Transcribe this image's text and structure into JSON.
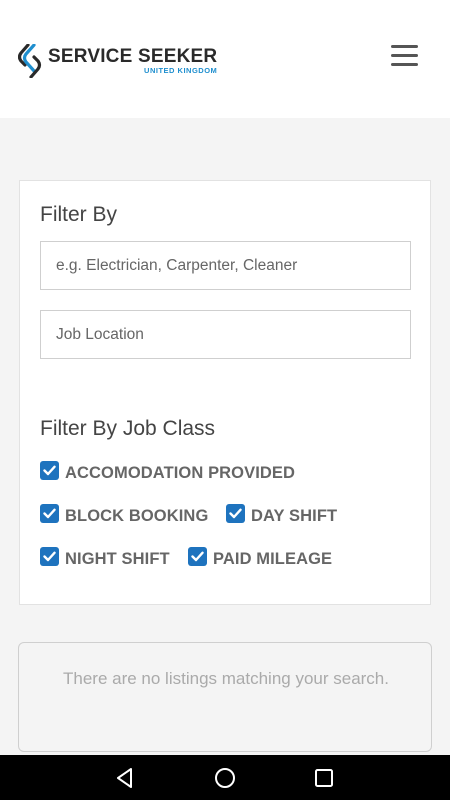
{
  "header": {
    "brand_title": "SERVICE SEEKER",
    "brand_subtitle": "UNITED KINGDOM",
    "menu_icon": "hamburger-menu-icon"
  },
  "filter": {
    "title": "Filter By",
    "keyword_placeholder": "e.g. Electrician, Carpenter, Cleaner",
    "keyword_value": "",
    "location_placeholder": "Job Location",
    "location_value": "",
    "job_class_title": "Filter By Job Class",
    "job_classes": [
      {
        "label": "ACCOMODATION PROVIDED",
        "checked": true
      },
      {
        "label": "BLOCK BOOKING",
        "checked": true
      },
      {
        "label": "DAY SHIFT",
        "checked": true
      },
      {
        "label": "NIGHT SHIFT",
        "checked": true
      },
      {
        "label": "PAID MILEAGE",
        "checked": true
      }
    ]
  },
  "results": {
    "empty_message": "There are no listings matching your search."
  },
  "navbar": {
    "icons": [
      "back-icon",
      "home-icon",
      "recents-icon"
    ]
  },
  "colors": {
    "accent": "#1e73be",
    "brand_blue": "#1f8fcf"
  }
}
